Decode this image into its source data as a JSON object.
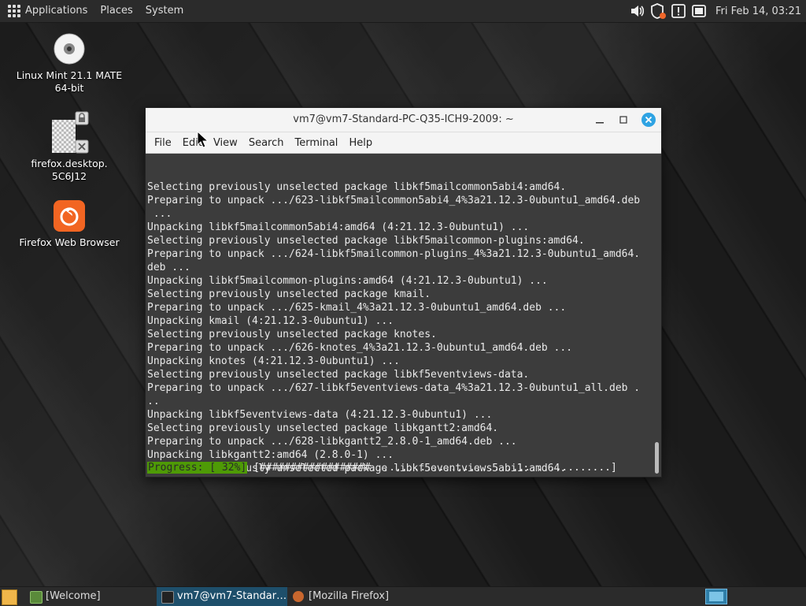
{
  "top_panel": {
    "menus": [
      "Applications",
      "Places",
      "System"
    ],
    "clock": "Fri Feb 14, 03:21"
  },
  "desktop": {
    "icons": [
      {
        "label": "Linux Mint 21.1 MATE 64-bit",
        "icon": "disc-icon"
      },
      {
        "label": "firefox.desktop. 5C6J12",
        "icon": "untrusted-launcher-icon"
      },
      {
        "label": "Firefox Web Browser",
        "icon": "firefox-icon"
      }
    ]
  },
  "terminal": {
    "title": "vm7@vm7-Standard-PC-Q35-ICH9-2009: ~",
    "menu": [
      "File",
      "Edit",
      "View",
      "Search",
      "Terminal",
      "Help"
    ],
    "lines": [
      "Selecting previously unselected package libkf5mailcommon5abi4:amd64.",
      "Preparing to unpack .../623-libkf5mailcommon5abi4_4%3a21.12.3-0ubuntu1_amd64.deb",
      " ...",
      "Unpacking libkf5mailcommon5abi4:amd64 (4:21.12.3-0ubuntu1) ...",
      "Selecting previously unselected package libkf5mailcommon-plugins:amd64.",
      "Preparing to unpack .../624-libkf5mailcommon-plugins_4%3a21.12.3-0ubuntu1_amd64.",
      "deb ...",
      "Unpacking libkf5mailcommon-plugins:amd64 (4:21.12.3-0ubuntu1) ...",
      "Selecting previously unselected package kmail.",
      "Preparing to unpack .../625-kmail_4%3a21.12.3-0ubuntu1_amd64.deb ...",
      "Unpacking kmail (4:21.12.3-0ubuntu1) ...",
      "Selecting previously unselected package knotes.",
      "Preparing to unpack .../626-knotes_4%3a21.12.3-0ubuntu1_amd64.deb ...",
      "Unpacking knotes (4:21.12.3-0ubuntu1) ...",
      "Selecting previously unselected package libkf5eventviews-data.",
      "Preparing to unpack .../627-libkf5eventviews-data_4%3a21.12.3-0ubuntu1_all.deb .",
      "..",
      "Unpacking libkf5eventviews-data (4:21.12.3-0ubuntu1) ...",
      "Selecting previously unselected package libkgantt2:amd64.",
      "Preparing to unpack .../628-libkgantt2_2.8.0-1_amd64.deb ...",
      "Unpacking libkgantt2:amd64 (2.8.0-1) ...",
      "Selecting previously unselected package libkf5eventviews5abi1:amd64."
    ],
    "progress_label": "Progress: [ 32%]",
    "progress_bar": "[##################.......................................]",
    "progress_percent": 32
  },
  "taskbar": {
    "tasks": [
      {
        "label": "[Welcome]",
        "icon": "mint-welcome-icon"
      },
      {
        "label": "vm7@vm7-Standar…",
        "icon": "terminal-icon"
      },
      {
        "label": "[Mozilla Firefox]",
        "icon": "firefox-icon"
      }
    ]
  }
}
